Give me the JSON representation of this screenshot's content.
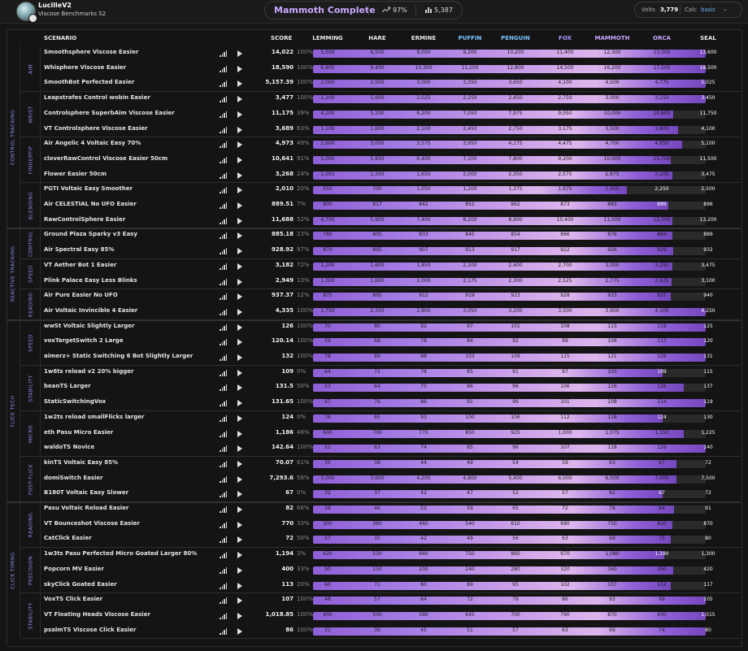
{
  "user": {
    "name": "LucilleV2",
    "benchmark": "Viscose Benchmarks S2"
  },
  "summary": {
    "rank": "Mammoth Complete",
    "progress": "97%",
    "score": "5,387"
  },
  "volts": {
    "label": "Volts",
    "value": "3,779",
    "calc_label": "Calc",
    "calc_value": "basic",
    "chevron": "⌄"
  },
  "headers": {
    "scenario": "SCENARIO",
    "score": "SCORE"
  },
  "tiers": [
    {
      "name": "LEMMING",
      "color": "#e8e8e8"
    },
    {
      "name": "HARE",
      "color": "#e8e8e8"
    },
    {
      "name": "ERMINE",
      "color": "#e8e8e8"
    },
    {
      "name": "PUFFIN",
      "color": "#7cc4ff"
    },
    {
      "name": "PENGUIN",
      "color": "#7cc4ff"
    },
    {
      "name": "FOX",
      "color": "#a49bff"
    },
    {
      "name": "MAMMOTH",
      "color": "#c9a8ff"
    },
    {
      "name": "ORCA",
      "color": "#c9a8ff"
    },
    {
      "name": "SEAL",
      "color": "#e8e8e8"
    }
  ],
  "categories": [
    {
      "name": "CONTROL TRACKING",
      "rows": 12
    },
    {
      "name": "REACTIVE TRACKING",
      "rows": 6
    },
    {
      "name": "FLICK TECH",
      "rows": 12
    },
    {
      "name": "CLICK TIMING",
      "rows": 9
    }
  ],
  "subcategories": [
    {
      "name": "AIM",
      "rows": 3
    },
    {
      "name": "WRIST",
      "rows": 3
    },
    {
      "name": "FINGERTIP",
      "rows": 3
    },
    {
      "name": "BLENDING",
      "rows": 3
    },
    {
      "name": "CONTROL",
      "rows": 2
    },
    {
      "name": "SPEED",
      "rows": 2
    },
    {
      "name": "READING",
      "rows": 2
    },
    {
      "name": "SPEED",
      "rows": 3
    },
    {
      "name": "STABILITY",
      "rows": 3
    },
    {
      "name": "MICRO",
      "rows": 3
    },
    {
      "name": "POST-FLICK",
      "rows": 3
    },
    {
      "name": "READING",
      "rows": 3
    },
    {
      "name": "PRECISION",
      "rows": 3
    },
    {
      "name": "STABILITY",
      "rows": 3
    }
  ],
  "rows": [
    {
      "name": "Smoothsphere Viscose Easier",
      "score": "14,022",
      "pct": "100%",
      "fill": 1.0,
      "tiers": [
        "5,500",
        "6,500",
        "8,050",
        "9,200",
        "10,200",
        "11,400",
        "12,300",
        "13,300",
        "13,600"
      ]
    },
    {
      "name": "Whisphere Viscose Easier",
      "score": "18,590",
      "pct": "100%",
      "fill": 1.0,
      "tiers": [
        "6,800",
        "9,400",
        "10,300",
        "11,100",
        "12,800",
        "14,500",
        "16,200",
        "17,500",
        "18,500"
      ]
    },
    {
      "name": "SmoothBot Perfected Easier",
      "score": "5,157.39",
      "pct": "100%",
      "fill": 1.0,
      "tiers": [
        "2,000",
        "2,500",
        "3,000",
        "3,350",
        "3,650",
        "4,100",
        "4,500",
        "4,775",
        "5,025"
      ]
    },
    {
      "name": "Leapstrafes Control wobin Easier",
      "score": "3,477",
      "pct": "100%",
      "fill": 1.0,
      "tiers": [
        "1,200",
        "1,600",
        "2,025",
        "2,250",
        "2,450",
        "2,750",
        "3,000",
        "3,250",
        "3,450"
      ]
    },
    {
      "name": "Controlsphere SuperbAim Viscose Easier",
      "score": "11,175",
      "pct": "39%",
      "fill": 0.918,
      "tiers": [
        "4,200",
        "5,100",
        "6,200",
        "7,050",
        "7,975",
        "9,050",
        "10,000",
        "10,800",
        "11,750"
      ]
    },
    {
      "name": "VT Controlsphere Viscose Easier",
      "score": "3,689",
      "pct": "63%",
      "fill": 0.93,
      "tiers": [
        "1,100",
        "1,600",
        "2,100",
        "2,450",
        "2,750",
        "3,175",
        "3,500",
        "3,800",
        "4,100"
      ]
    },
    {
      "name": "Air Angelic 4 Voltaic Easy 70%",
      "score": "4,973",
      "pct": "49%",
      "fill": 0.94,
      "tiers": [
        "2,600",
        "3,050",
        "3,575",
        "3,950",
        "4,175",
        "4,475",
        "4,700",
        "4,850",
        "5,100"
      ]
    },
    {
      "name": "cloverRawControl Viscose Easier 50cm",
      "score": "10,641",
      "pct": "91%",
      "fill": 0.91,
      "tiers": [
        "5,000",
        "5,850",
        "6,400",
        "7,100",
        "7,800",
        "9,200",
        "10,000",
        "10,700",
        "11,500"
      ]
    },
    {
      "name": "Flower Easier 50cm",
      "score": "3,268",
      "pct": "24%",
      "fill": 0.915,
      "tiers": [
        "1,050",
        "1,350",
        "1,650",
        "2,000",
        "2,350",
        "2,575",
        "2,875",
        "3,200",
        "3,475"
      ]
    },
    {
      "name": "PGTI Voltaic Easy Smoother",
      "score": "2,010",
      "pct": "20%",
      "fill": 0.8,
      "tiers": [
        "550",
        "700",
        "1,050",
        "1,200",
        "1,375",
        "1,675",
        "1,950",
        "2,250",
        "2,500"
      ]
    },
    {
      "name": "Air CELESTIAL No UFO Easier",
      "score": "889.51",
      "pct": "7%",
      "fill": 0.905,
      "tiers": [
        "800",
        "817",
        "842",
        "852",
        "862",
        "873",
        "883",
        "889",
        "896"
      ]
    },
    {
      "name": "RawControlSphere Easier",
      "score": "11,688",
      "pct": "52%",
      "fill": 0.915,
      "tiers": [
        "4,700",
        "5,900",
        "7,400",
        "8,200",
        "8,900",
        "10,400",
        "11,000",
        "12,300",
        "13,200"
      ]
    },
    {
      "name": "Ground Plaza Sparky v3 Easy",
      "score": "885.18",
      "pct": "23%",
      "fill": 0.915,
      "tiers": [
        "780",
        "805",
        "833",
        "845",
        "854",
        "866",
        "876",
        "884",
        "889"
      ]
    },
    {
      "name": "Air Spectral Easy 85%",
      "score": "928.92",
      "pct": "97%",
      "fill": 0.918,
      "tiers": [
        "870",
        "895",
        "907",
        "913",
        "917",
        "922",
        "926",
        "929",
        "932"
      ]
    },
    {
      "name": "VT Aether Bot 1 Easier",
      "score": "3,182",
      "pct": "72%",
      "fill": 0.915,
      "tiers": [
        "1,200",
        "1,600",
        "1,850",
        "2,100",
        "2,400",
        "2,700",
        "3,000",
        "3,250",
        "3,475"
      ]
    },
    {
      "name": "Plink Palace Easy Less Blinks",
      "score": "2,949",
      "pct": "13%",
      "fill": 0.913,
      "tiers": [
        "1,300",
        "1,600",
        "2,000",
        "2,175",
        "2,300",
        "2,525",
        "2,775",
        "2,925",
        "3,100"
      ]
    },
    {
      "name": "Air Pure Easier No UFO",
      "score": "937.37",
      "pct": "12%",
      "fill": 0.91,
      "tiers": [
        "875",
        "895",
        "912",
        "919",
        "923",
        "928",
        "933",
        "937",
        "940"
      ]
    },
    {
      "name": "Air Voltaic Invincible 4 Easier",
      "score": "4,335",
      "pct": "100%",
      "fill": 1.0,
      "tiers": [
        "1,750",
        "2,350",
        "2,800",
        "3,050",
        "3,200",
        "3,500",
        "3,900",
        "4,100",
        "4,250"
      ]
    },
    {
      "name": "wwSt Voltaic Slightly Larger",
      "score": "126",
      "pct": "100%",
      "fill": 1.0,
      "tiers": [
        "70",
        "80",
        "92",
        "97",
        "101",
        "108",
        "113",
        "119",
        "125"
      ]
    },
    {
      "name": "voxTargetSwitch 2 Large",
      "score": "120.14",
      "pct": "100%",
      "fill": 1.0,
      "tiers": [
        "59",
        "68",
        "78",
        "84",
        "92",
        "99",
        "106",
        "113",
        "120"
      ]
    },
    {
      "name": "aimerz+ Static Switching 6 Bot Slightly Larger",
      "score": "132",
      "pct": "100%",
      "fill": 1.0,
      "tiers": [
        "78",
        "89",
        "98",
        "103",
        "109",
        "115",
        "121",
        "126",
        "131"
      ]
    },
    {
      "name": "1w6ts reload v2 20% bigger",
      "score": "109",
      "pct": "0%",
      "fill": 0.89,
      "tiers": [
        "64",
        "71",
        "78",
        "85",
        "91",
        "97",
        "103",
        "109",
        "115"
      ]
    },
    {
      "name": "beanTS Larger",
      "score": "131.5",
      "pct": "50%",
      "fill": 0.945,
      "tiers": [
        "53",
        "64",
        "75",
        "86",
        "96",
        "106",
        "116",
        "126",
        "137"
      ]
    },
    {
      "name": "StaticSwitchingVox",
      "score": "131.65",
      "pct": "100%",
      "fill": 1.0,
      "tiers": [
        "67",
        "76",
        "86",
        "91",
        "96",
        "101",
        "108",
        "114",
        "119"
      ]
    },
    {
      "name": "1w2ts reload smallFlicks larger",
      "score": "124",
      "pct": "0%",
      "fill": 0.89,
      "tiers": [
        "76",
        "85",
        "93",
        "100",
        "106",
        "112",
        "118",
        "124",
        "130"
      ]
    },
    {
      "name": "eth Pasu Micro Easier",
      "score": "1,186",
      "pct": "48%",
      "fill": 0.945,
      "tiers": [
        "600",
        "700",
        "775",
        "850",
        "925",
        "1,000",
        "1,075",
        "1,150",
        "1,225"
      ]
    },
    {
      "name": "waldoTS Novice",
      "score": "142.64",
      "pct": "100%",
      "fill": 1.0,
      "tiers": [
        "51",
        "63",
        "74",
        "85",
        "96",
        "107",
        "118",
        "129",
        "140"
      ]
    },
    {
      "name": "kinTS Voltaic Easy 85%",
      "score": "70.07",
      "pct": "61%",
      "fill": 0.925,
      "tiers": [
        "35",
        "38",
        "44",
        "49",
        "54",
        "59",
        "63",
        "67",
        "72"
      ]
    },
    {
      "name": "domiSwitch Easier",
      "score": "7,293.6",
      "pct": "58%",
      "fill": 0.925,
      "tiers": [
        "3,000",
        "3,600",
        "4,200",
        "4,800",
        "5,400",
        "6,000",
        "6,500",
        "7,000",
        "7,500"
      ]
    },
    {
      "name": "B180T Voltaic Easy Slower",
      "score": "67",
      "pct": "0%",
      "fill": 0.89,
      "tiers": [
        "32",
        "37",
        "42",
        "47",
        "52",
        "57",
        "62",
        "67",
        "72"
      ]
    },
    {
      "name": "Pasu Voltaic Reload Easier",
      "score": "82",
      "pct": "66%",
      "fill": 0.92,
      "tiers": [
        "38",
        "46",
        "52",
        "59",
        "65",
        "72",
        "78",
        "84",
        "91"
      ]
    },
    {
      "name": "VT Bounceshot Viscose Easier",
      "score": "770",
      "pct": "33%",
      "fill": 0.915,
      "tiers": [
        "300",
        "380",
        "460",
        "540",
        "610",
        "690",
        "750",
        "810",
        "870"
      ]
    },
    {
      "name": "CatClick Easier",
      "score": "72",
      "pct": "50%",
      "fill": 0.91,
      "tiers": [
        "27",
        "35",
        "42",
        "49",
        "56",
        "63",
        "69",
        "75",
        "80"
      ]
    },
    {
      "name": "1w3ts Pasu Perfected Micro Goated Larger 80%",
      "score": "1,194",
      "pct": "3%",
      "fill": 0.895,
      "tiers": [
        "420",
        "530",
        "640",
        "750",
        "860",
        "970",
        "1,080",
        "1,190",
        "1,300"
      ]
    },
    {
      "name": "Popcorn MV Easier",
      "score": "400",
      "pct": "33%",
      "fill": 0.918,
      "tiers": [
        "90",
        "150",
        "200",
        "240",
        "280",
        "320",
        "360",
        "390",
        "420"
      ]
    },
    {
      "name": "skyClick Goated Easier",
      "score": "113",
      "pct": "20%",
      "fill": 0.91,
      "tiers": [
        "60",
        "71",
        "80",
        "89",
        "95",
        "102",
        "107",
        "112",
        "117"
      ]
    },
    {
      "name": "VoxTS Click Easier",
      "score": "107",
      "pct": "100%",
      "fill": 1.0,
      "tiers": [
        "48",
        "57",
        "64",
        "72",
        "79",
        "86",
        "93",
        "99",
        "105"
      ]
    },
    {
      "name": "VT Floating Heads Viscose Easier",
      "score": "1,018.85",
      "pct": "100%",
      "fill": 1.0,
      "tiers": [
        "400",
        "500",
        "580",
        "645",
        "700",
        "790",
        "870",
        "930",
        "1,015"
      ]
    },
    {
      "name": "psalmTS Viscose Click Easier",
      "score": "86",
      "pct": "100%",
      "fill": 1.0,
      "tiers": [
        "31",
        "39",
        "45",
        "51",
        "57",
        "63",
        "69",
        "74",
        "80"
      ]
    }
  ]
}
